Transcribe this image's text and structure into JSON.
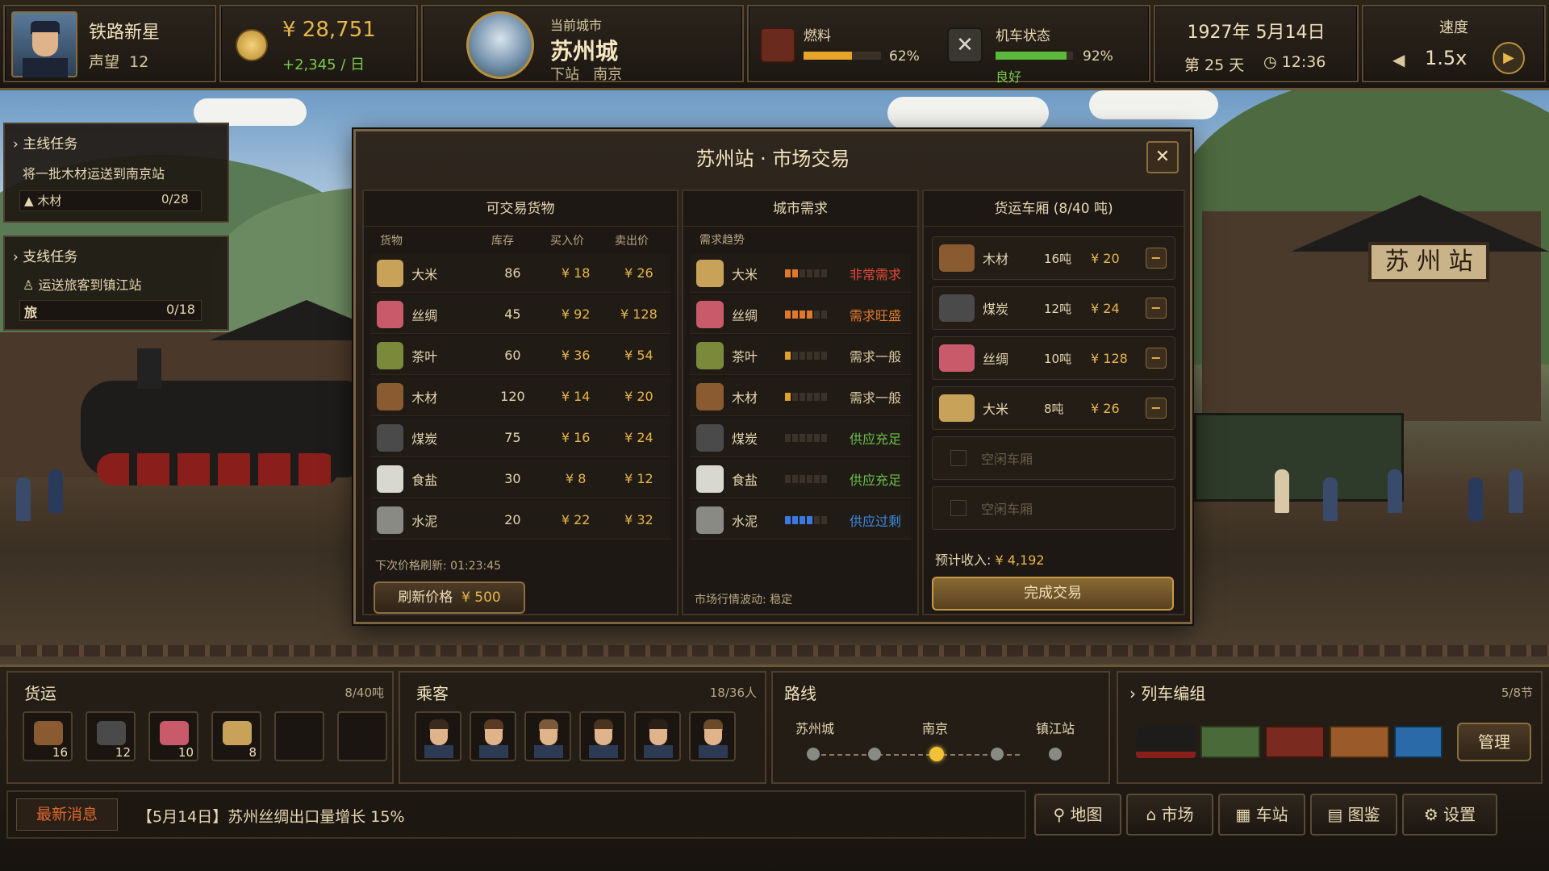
{
  "player": {
    "name": "铁路新星",
    "rep_label": "声望",
    "rep": "12"
  },
  "money": {
    "amount": "¥ 28,751",
    "rate": "+2,345 / 日"
  },
  "city": {
    "label": "当前城市",
    "name": "苏州城",
    "next_label": "下站",
    "next": "南京"
  },
  "fuel": {
    "label": "燃料",
    "pct": "62%",
    "value": 0.62
  },
  "engine": {
    "label": "机车状态",
    "pct": "92%",
    "status": "良好",
    "value": 0.92
  },
  "date": {
    "date": "1927年  5月14日",
    "day": "第 25 天",
    "time": "12:36"
  },
  "speed": {
    "label": "速度",
    "value": "1.5x"
  },
  "quests": {
    "main_title": "主线任务",
    "main_desc": "将一批木材运送到南京站",
    "main_item": "木材",
    "main_prog": "0/28",
    "side_title": "支线任务",
    "side_desc": "运送旅客到镇江站",
    "side_item": "旅",
    "side_prog": "0/18"
  },
  "modal": {
    "title": "苏州站 · 市场交易",
    "close": "✕"
  },
  "goods": {
    "title": "可交易货物",
    "headers": [
      "货物",
      "库存",
      "买入价",
      "卖出价"
    ],
    "rows": [
      {
        "name": "大米",
        "stock": "86",
        "buy": "¥ 18",
        "sell": "¥ 26",
        "icon": "rice-sack-icon",
        "color": "#c9a25a"
      },
      {
        "name": "丝绸",
        "stock": "45",
        "buy": "¥ 92",
        "sell": "¥ 128",
        "icon": "silk-icon",
        "color": "#c85a6a"
      },
      {
        "name": "茶叶",
        "stock": "60",
        "buy": "¥ 36",
        "sell": "¥ 54",
        "icon": "tea-icon",
        "color": "#7a8a3a"
      },
      {
        "name": "木材",
        "stock": "120",
        "buy": "¥ 14",
        "sell": "¥ 20",
        "icon": "wood-icon",
        "color": "#8a5a30"
      },
      {
        "name": "煤炭",
        "stock": "75",
        "buy": "¥ 16",
        "sell": "¥ 24",
        "icon": "coal-icon",
        "color": "#4a4a4a"
      },
      {
        "name": "食盐",
        "stock": "30",
        "buy": "¥ 8",
        "sell": "¥ 12",
        "icon": "salt-icon",
        "color": "#d8d8d0"
      },
      {
        "name": "水泥",
        "stock": "20",
        "buy": "¥ 22",
        "sell": "¥ 32",
        "icon": "cement-icon",
        "color": "#8a8a84"
      }
    ],
    "refresh_label": "下次价格刷新:",
    "refresh_time": "01:23:45",
    "refresh_btn": "刷新价格",
    "refresh_cost": "¥ 500"
  },
  "demand": {
    "title": "城市需求",
    "header": "需求趋势",
    "rows": [
      {
        "name": "大米",
        "status": "非常需求",
        "color": "#e04a3a",
        "level": 2,
        "bar": "#e0782a"
      },
      {
        "name": "丝绸",
        "status": "需求旺盛",
        "color": "#e07a2a",
        "level": 4,
        "bar": "#e0782a"
      },
      {
        "name": "茶叶",
        "status": "需求一般",
        "color": "#d8c8a0",
        "level": 1,
        "bar": "#e0a02a"
      },
      {
        "name": "木材",
        "status": "需求一般",
        "color": "#d8c8a0",
        "level": 1,
        "bar": "#e0a02a"
      },
      {
        "name": "煤炭",
        "status": "供应充足",
        "color": "#6ac04a",
        "level": 0,
        "bar": "#6ac04a"
      },
      {
        "name": "食盐",
        "status": "供应充足",
        "color": "#6ac04a",
        "level": 0,
        "bar": "#6ac04a"
      },
      {
        "name": "水泥",
        "status": "供应过剩",
        "color": "#3a8ae0",
        "level": 4,
        "bar": "#3a7ae0"
      }
    ],
    "footer": "市场行情波动: 稳定"
  },
  "cargo": {
    "title": "货运车厢 (8/40 吨)",
    "rows": [
      {
        "name": "木材",
        "qty": "16吨",
        "price": "¥ 20",
        "icon": "wood-icon",
        "color": "#8a5a30"
      },
      {
        "name": "煤炭",
        "qty": "12吨",
        "price": "¥ 24",
        "icon": "coal-icon",
        "color": "#4a4a4a"
      },
      {
        "name": "丝绸",
        "qty": "10吨",
        "price": "¥ 128",
        "icon": "silk-icon",
        "color": "#c85a6a"
      },
      {
        "name": "大米",
        "qty": "8吨",
        "price": "¥ 26",
        "icon": "rice-sack-icon",
        "color": "#c9a25a"
      }
    ],
    "empty": [
      "空闲车厢",
      "空闲车厢"
    ],
    "income_label": "预计收入:",
    "income": "¥ 4,192",
    "confirm": "完成交易",
    "minus": "−"
  },
  "freight": {
    "title": "货运",
    "count": "8/40吨",
    "slots": [
      {
        "qty": "16",
        "color": "#8a5a30",
        "icon": "wood-icon"
      },
      {
        "qty": "12",
        "color": "#4a4a4a",
        "icon": "coal-icon"
      },
      {
        "qty": "10",
        "color": "#c85a6a",
        "icon": "silk-icon"
      },
      {
        "qty": "8",
        "color": "#c9a25a",
        "icon": "rice-sack-icon"
      }
    ]
  },
  "passengers": {
    "title": "乘客",
    "count": "18/36人"
  },
  "route": {
    "title": "路线",
    "stops": [
      "苏州城",
      "南京",
      "镇江站"
    ]
  },
  "train": {
    "title": "列车编组",
    "count": "5/8节",
    "manage": "管理"
  },
  "news": {
    "label": "最新消息",
    "text": "【5月14日】苏州丝绸出口量增长 15%"
  },
  "nav": [
    "地图",
    "市场",
    "车站",
    "图鉴",
    "设置"
  ],
  "station_sign": "苏 州 站",
  "colors": {
    "accent": "#e7b64a",
    "panel": "#231d16",
    "border": "#6b5638"
  }
}
